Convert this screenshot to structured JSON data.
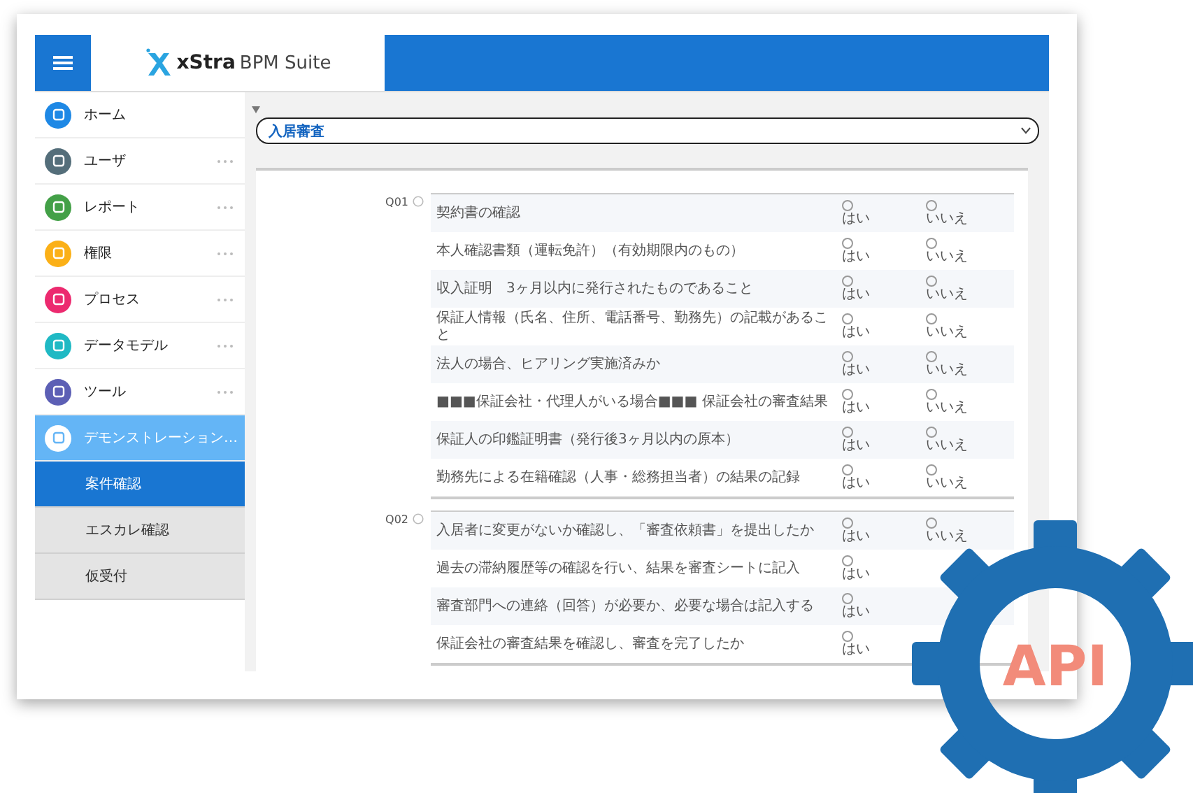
{
  "header": {
    "logo_text": "xStra",
    "logo_suffix": "BPM Suite"
  },
  "sidebar": {
    "items": [
      {
        "label": "ホーム",
        "color": "#1e88e5",
        "more": false,
        "selected": false
      },
      {
        "label": "ユーザ",
        "color": "#546e7a",
        "more": true,
        "selected": false
      },
      {
        "label": "レポート",
        "color": "#43a047",
        "more": true,
        "selected": false
      },
      {
        "label": "権限",
        "color": "#fbb017",
        "more": true,
        "selected": false
      },
      {
        "label": "プロセス",
        "color": "#ec2a6f",
        "more": true,
        "selected": false
      },
      {
        "label": "データモデル",
        "color": "#1fb9c4",
        "more": true,
        "selected": false
      },
      {
        "label": "ツール",
        "color": "#5c5fb5",
        "more": true,
        "selected": false
      },
      {
        "label": "デモンストレーション…",
        "color": "#ffffff",
        "more": false,
        "selected": true,
        "children": [
          {
            "label": "案件確認",
            "selected": true
          },
          {
            "label": "エスカレ確認",
            "selected": false
          },
          {
            "label": "仮受付",
            "selected": false
          }
        ]
      }
    ]
  },
  "select": {
    "value": "入居審査"
  },
  "sections": [
    {
      "label": "Q01",
      "rows": [
        {
          "text": "契約書の確認",
          "options": [
            {
              "label": "はい",
              "selected": false
            },
            {
              "label": "いいえ",
              "selected": false
            }
          ]
        },
        {
          "text": "本人確認書類（運転免許）（有効期限内のもの）",
          "options": [
            {
              "label": "はい",
              "selected": false
            },
            {
              "label": "いいえ",
              "selected": false
            }
          ]
        },
        {
          "text": "収入証明　3ヶ月以内に発行されたものであること",
          "options": [
            {
              "label": "はい",
              "selected": false
            },
            {
              "label": "いいえ",
              "selected": false
            }
          ]
        },
        {
          "text": "保証人情報（氏名、住所、電話番号、勤務先）の記載があること",
          "options": [
            {
              "label": "はい",
              "selected": false
            },
            {
              "label": "いいえ",
              "selected": false
            }
          ]
        },
        {
          "text": "法人の場合、ヒアリング実施済みか",
          "options": [
            {
              "label": "はい",
              "selected": false
            },
            {
              "label": "いいえ",
              "selected": false
            }
          ]
        },
        {
          "text": "■■■保証会社・代理人がいる場合■■■ 保証会社の審査結果",
          "options": [
            {
              "label": "はい",
              "selected": false
            },
            {
              "label": "いいえ",
              "selected": false
            }
          ]
        },
        {
          "text": "保証人の印鑑証明書（発行後3ヶ月以内の原本）",
          "options": [
            {
              "label": "はい",
              "selected": false
            },
            {
              "label": "いいえ",
              "selected": false
            }
          ]
        },
        {
          "text": "勤務先による在籍確認（人事・総務担当者）の結果の記録",
          "options": [
            {
              "label": "はい",
              "selected": false
            },
            {
              "label": "いいえ",
              "selected": false
            }
          ]
        }
      ]
    },
    {
      "label": "Q02",
      "rows": [
        {
          "text": "入居者に変更がないか確認し、「審査依頼書」を提出したか",
          "options": [
            {
              "label": "はい",
              "selected": false
            },
            {
              "label": "いいえ",
              "selected": false
            }
          ]
        },
        {
          "text": "過去の滞納履歴等の確認を行い、結果を審査シートに記入",
          "options": [
            {
              "label": "はい",
              "selected": false
            }
          ]
        },
        {
          "text": "審査部門への連絡（回答）が必要か、必要な場合は記入する",
          "options": [
            {
              "label": "はい",
              "selected": false
            }
          ]
        },
        {
          "text": "保証会社の審査結果を確認し、審査を完了したか",
          "options": [
            {
              "label": "はい",
              "selected": false
            }
          ]
        }
      ]
    }
  ],
  "badge": {
    "label": "API"
  }
}
